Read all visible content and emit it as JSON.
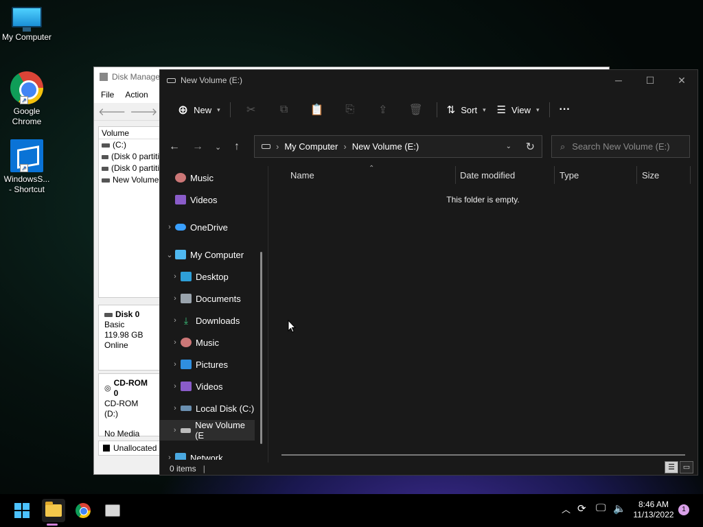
{
  "desktop": {
    "icons": [
      {
        "label": "My Computer"
      },
      {
        "label": "Google Chrome"
      },
      {
        "label": "WindowsS... - Shortcut"
      }
    ]
  },
  "disk_mgmt": {
    "title": "Disk Manage",
    "menu": [
      "File",
      "Action"
    ],
    "volume_header": "Volume",
    "volumes": [
      "(C:)",
      "(Disk 0 partiti",
      "(Disk 0 partiti",
      "New Volume"
    ],
    "disk0": {
      "name": "Disk 0",
      "type": "Basic",
      "size": "119.98 GB",
      "status": "Online"
    },
    "cdrom": {
      "name": "CD-ROM 0",
      "drive": "CD-ROM (D:)",
      "media": "No Media"
    },
    "legend_unallocated": "Unallocated"
  },
  "explorer": {
    "title": "New Volume (E:)",
    "cmd": {
      "new": "New",
      "sort": "Sort",
      "view": "View",
      "more": "···"
    },
    "breadcrumb": [
      "My Computer",
      "New Volume (E:)"
    ],
    "search_placeholder": "Search New Volume (E:)",
    "nav": {
      "music_top": "Music",
      "videos_top": "Videos",
      "onedrive": "OneDrive",
      "mycomputer": "My Computer",
      "desktop": "Desktop",
      "documents": "Documents",
      "downloads": "Downloads",
      "music": "Music",
      "pictures": "Pictures",
      "videos": "Videos",
      "localdisk": "Local Disk (C:)",
      "newvolume": "New Volume (E",
      "network": "Network"
    },
    "columns": {
      "name": "Name",
      "date": "Date modified",
      "type": "Type",
      "size": "Size"
    },
    "empty_message": "This folder is empty.",
    "status": "0 items"
  },
  "taskbar": {
    "time": "8:46 AM",
    "date": "11/13/2022",
    "notifications": "1"
  }
}
